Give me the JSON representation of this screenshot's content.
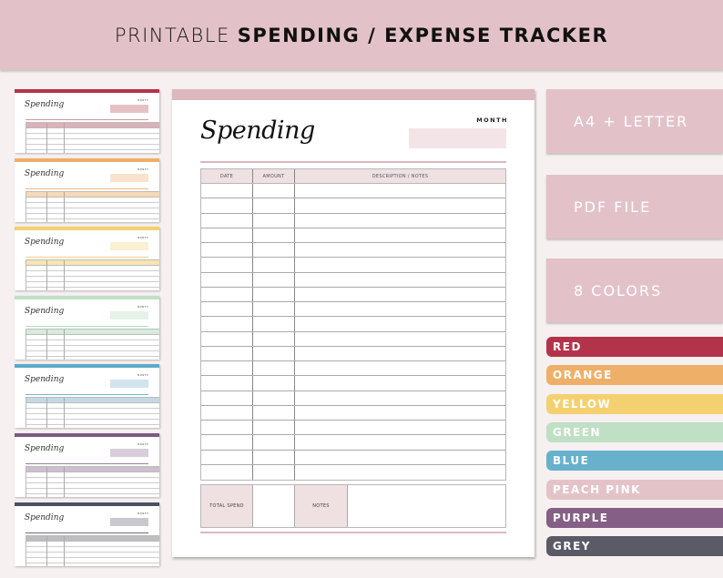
{
  "banner": {
    "title_light": "PRINTABLE",
    "title_bold": "SPENDING / EXPENSE TRACKER"
  },
  "thumbnails": [
    {
      "color": "red",
      "bar": "#b3344a",
      "fill": "#e5c1c6",
      "header": "#dcb2b8",
      "rule": "#c99aa1",
      "title": "Spending",
      "month": "MONTH"
    },
    {
      "color": "orange",
      "bar": "#eeae69",
      "fill": "#f9e3cc",
      "header": "#f6d9b6",
      "rule": "#eeb97c",
      "title": "Spending",
      "month": "MONTH"
    },
    {
      "color": "yellow",
      "bar": "#f3d070",
      "fill": "#fbefd1",
      "header": "#f8e4b2",
      "rule": "#f0cf7f",
      "title": "Spending",
      "month": "MONTH"
    },
    {
      "color": "green",
      "bar": "#bfe0c5",
      "fill": "#e6f2e8",
      "header": "#d7ebda",
      "rule": "#b6d9bd",
      "title": "Spending",
      "month": "MONTH"
    },
    {
      "color": "blue",
      "bar": "#5ea9c8",
      "fill": "#d2e4ec",
      "header": "#c4d9e3",
      "rule": "#7ab3cb",
      "title": "Spending",
      "month": "MONTH"
    },
    {
      "color": "purple",
      "bar": "#7d5a84",
      "fill": "#d8ccd9",
      "header": "#cdbfd0",
      "rule": "#9a7fa0",
      "title": "Spending",
      "month": "MONTH"
    },
    {
      "color": "grey",
      "bar": "#4e5060",
      "fill": "#c9c9cd",
      "header": "#bdbdc2",
      "rule": "#6a6b78",
      "title": "Spending",
      "month": "MONTH"
    }
  ],
  "page": {
    "title": "Spending",
    "month_label": "MONTH",
    "columns": [
      "DATE",
      "AMOUNT",
      "DESCRIPTION / NOTES"
    ],
    "row_count": 20,
    "total_label": "TOTAL SPEND",
    "notes_label": "NOTES"
  },
  "features": [
    "A4 + LETTER",
    "PDF FILE",
    "8 COLORS"
  ],
  "colors": [
    {
      "label": "RED",
      "hex": "#b3344a"
    },
    {
      "label": "ORANGE",
      "hex": "#eeb068"
    },
    {
      "label": "YELLOW",
      "hex": "#f4d170"
    },
    {
      "label": "GREEN",
      "hex": "#bfe0c4"
    },
    {
      "label": "BLUE",
      "hex": "#67b1cc"
    },
    {
      "label": "PEACH PINK",
      "hex": "#e4c3c8"
    },
    {
      "label": "PURPLE",
      "hex": "#855f86"
    },
    {
      "label": "GREY",
      "hex": "#5a5b66"
    }
  ]
}
